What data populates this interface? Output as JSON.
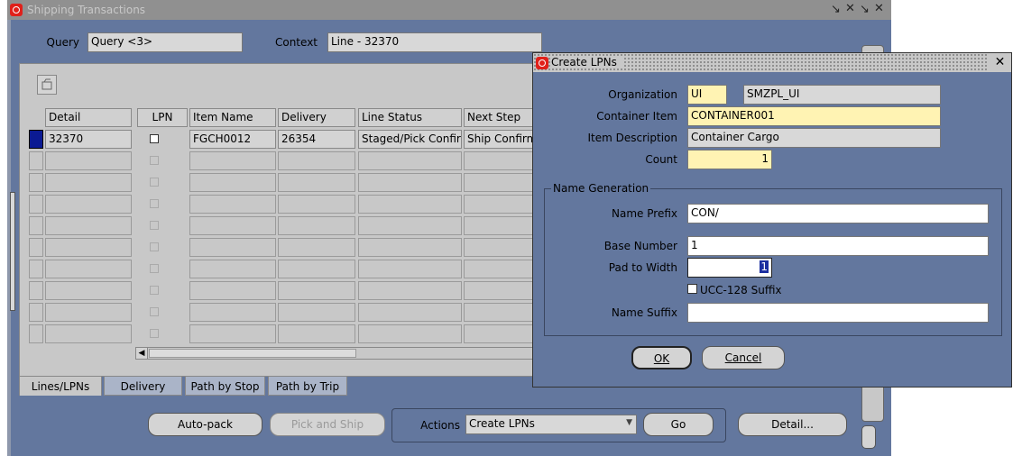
{
  "main_window": {
    "title": "Shipping Transactions",
    "query_label": "Query",
    "query_value": "Query <3>",
    "context_label": "Context",
    "context_value": "Line - 32370",
    "columns": [
      "Detail",
      "LPN",
      "Item Name",
      "Delivery",
      "Line Status",
      "Next Step"
    ],
    "rows": [
      {
        "detail": "32370",
        "item_name": "FGCH0012",
        "delivery": "26354",
        "line_status": "Staged/Pick Confirmed",
        "next_step": "Ship Confirm"
      }
    ],
    "empty_row_count": 9,
    "tabs": [
      "Lines/LPNs",
      "Delivery",
      "Path by Stop",
      "Path by Trip"
    ],
    "buttons": {
      "auto_pack": "Auto-pack",
      "pick_and_ship": "Pick and Ship",
      "actions_label": "Actions",
      "actions_value": "Create LPNs",
      "go": "Go",
      "detail": "Detail..."
    }
  },
  "dialog": {
    "title": "Create LPNs",
    "organization_label": "Organization",
    "organization_code": "UI",
    "organization_name": "SMZPL_UI",
    "container_item_label": "Container Item",
    "container_item_value": "CONTAINER001",
    "item_description_label": "Item Description",
    "item_description_value": "Container Cargo",
    "count_label": "Count",
    "count_value": "1",
    "name_generation_label": "Name Generation",
    "name_prefix_label": "Name Prefix",
    "name_prefix_value": "CON/",
    "base_number_label": "Base Number",
    "base_number_value": "1",
    "pad_to_width_label": "Pad to Width",
    "pad_to_width_value": "1",
    "ucc_suffix_label": "UCC-128 Suffix",
    "ucc_suffix_checked": false,
    "name_suffix_label": "Name Suffix",
    "name_suffix_value": "",
    "ok_label": "OK",
    "cancel_label": "Cancel"
  },
  "colors": {
    "window_bg": "#63779e",
    "panel_bg": "#c8c8c8",
    "required_field": "#fff3b3",
    "row_selected": "#0b1a93",
    "oracle_red": "#e0201a"
  }
}
